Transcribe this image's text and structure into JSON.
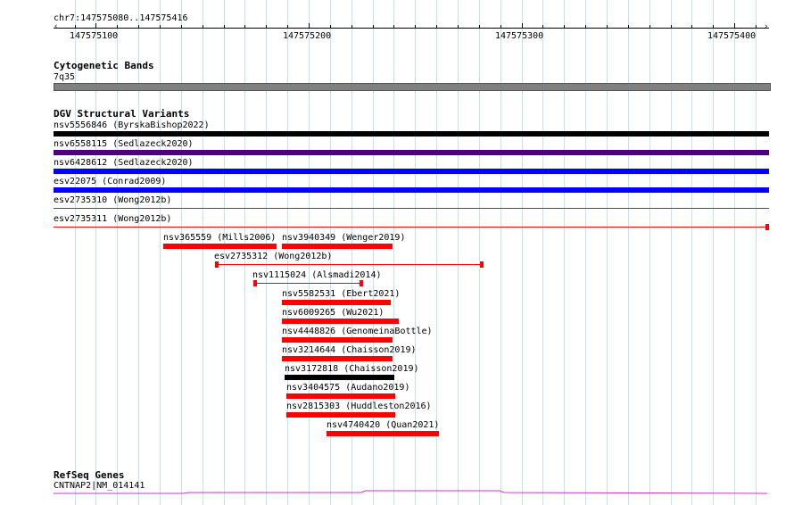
{
  "ruler": {
    "region": "chr7:147575080..147575416",
    "ticks": [
      "147575100",
      "147575200",
      "147575300",
      "147575400"
    ]
  },
  "cyto": {
    "title": "Cytogenetic Bands",
    "band": "7q35",
    "band_color": "#808080"
  },
  "dgv": {
    "title": "DGV Structural Variants",
    "variants": [
      {
        "label": "nsv5556846 (ByrskaBishop2022)",
        "color": "#000000"
      },
      {
        "label": "nsv6558115 (Sedlazeck2020)",
        "color": "#4b0082"
      },
      {
        "label": "nsv6428612 (Sedlazeck2020)",
        "color": "#0000ff"
      },
      {
        "label": "esv22075 (Conrad2009)",
        "color": "#0000ff"
      },
      {
        "label": "esv2735310 (Wong2012b)",
        "color": "#ff0000"
      },
      {
        "label": "esv2735311 (Wong2012b)",
        "color": "#ff0000"
      },
      {
        "label": "nsv365559 (Mills2006)",
        "color": "#ff0000"
      },
      {
        "label": "nsv3940349 (Wenger2019)",
        "color": "#ff0000"
      },
      {
        "label": "esv2735312 (Wong2012b)",
        "color": "#ff0000"
      },
      {
        "label": "nsv1115024 (Alsmadi2014)",
        "color": "#ff0000"
      },
      {
        "label": "nsv5582531 (Ebert2021)",
        "color": "#ff0000"
      },
      {
        "label": "nsv6009265 (Wu2021)",
        "color": "#ff0000"
      },
      {
        "label": "nsv4448826 (GenomeinaBottle)",
        "color": "#ff0000"
      },
      {
        "label": "nsv3214644 (Chaisson2019)",
        "color": "#ff0000"
      },
      {
        "label": "nsv3172818 (Chaisson2019)",
        "color": "#000000"
      },
      {
        "label": "nsv3404575 (Audano2019)",
        "color": "#ff0000"
      },
      {
        "label": "nsv2815303 (Huddleston2016)",
        "color": "#ff0000"
      },
      {
        "label": "nsv4740420 (Quan2021)",
        "color": "#ff0000"
      }
    ]
  },
  "refseq": {
    "title": "RefSeq Genes",
    "gene": "CNTNAP2|NM_014141",
    "color": "#cc33cc"
  }
}
